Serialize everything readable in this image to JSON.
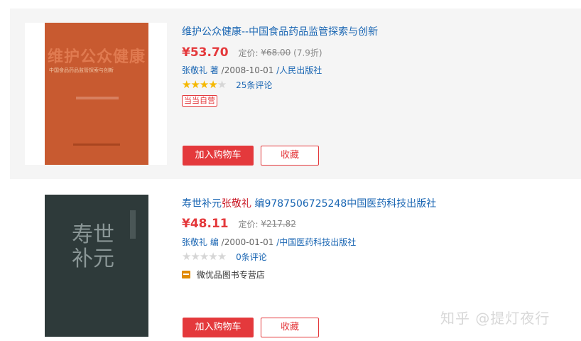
{
  "products": [
    {
      "cover_text": "维护公众健康",
      "cover_subtitle": "中国食品药品监管探索与创新",
      "title": "维护公众健康--中国食品药品监管探索与创新",
      "price": "¥53.70",
      "orig_label": "定价:",
      "orig_price": "¥68.00",
      "discount": "(7.9折)",
      "author": "张敬礼 著",
      "date": "/2008-10-01",
      "publisher": "/人民出版社",
      "rating": 4.5,
      "reviews": "25条评论",
      "badge": "当当自营",
      "cart_label": "加入购物车",
      "fav_label": "收藏"
    },
    {
      "cover_text": "寿世补元",
      "title_pre": "寿世补元",
      "title_keyword": "张敬礼",
      "title_post": " 编9787506725248中国医药科技出版社",
      "price": "¥48.11",
      "orig_label": "定价:",
      "orig_price": "¥217.82",
      "author": "张敬礼 编",
      "date": "/2000-01-01",
      "publisher": "/中国医药科技出版社",
      "rating": 0,
      "reviews": "0条评论",
      "shop_icon": "shop-icon",
      "shop_name": "微优品图书专营店",
      "cart_label": "加入购物车",
      "fav_label": "收藏"
    }
  ],
  "watermark": "知乎 @提灯夜行",
  "colors": {
    "price_red": "#e4393c",
    "link_blue": "#1a66b3",
    "star_gold": "#f5b800",
    "star_grey": "#d6d6d6"
  }
}
